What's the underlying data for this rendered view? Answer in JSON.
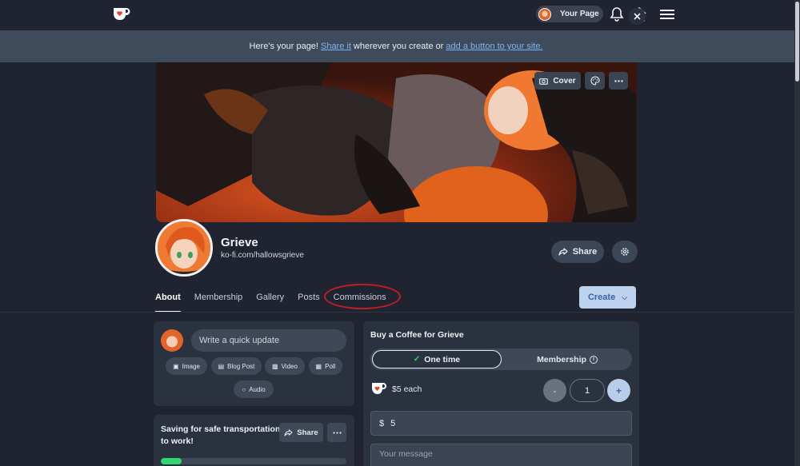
{
  "nav": {
    "your_page_label": "Your Page",
    "icons": [
      "kofi-logo-icon",
      "bell-icon",
      "home-icon",
      "menu-icon"
    ]
  },
  "banner": {
    "prefix": "Here's your page!",
    "link1": "Share it",
    "middle": "wherever you create or",
    "link2": "add a button to your site."
  },
  "cover": {
    "cover_label": "Cover"
  },
  "profile": {
    "name": "Grieve",
    "url": "ko-fi.com/hallowsgrieve",
    "share_label": "Share"
  },
  "tabs": [
    {
      "label": "About",
      "active": true
    },
    {
      "label": "Membership",
      "active": false
    },
    {
      "label": "Gallery",
      "active": false
    },
    {
      "label": "Posts",
      "active": false
    },
    {
      "label": "Commissions",
      "active": false
    }
  ],
  "create_label": "Create",
  "update": {
    "placeholder": "Write a quick update",
    "actions": [
      {
        "label": "Image",
        "icon": "image-icon"
      },
      {
        "label": "Blog Post",
        "icon": "blog-post-icon"
      },
      {
        "label": "Video",
        "icon": "video-icon"
      },
      {
        "label": "Poll",
        "icon": "poll-icon"
      },
      {
        "label": "Audio",
        "icon": "audio-icon"
      }
    ]
  },
  "goal": {
    "title": "Saving for safe transportation to work!",
    "share_label": "Share",
    "progress_fraction": 0.11,
    "progress_color": "#2fd86f"
  },
  "buy": {
    "title": "Buy a Coffee for Grieve",
    "one_time_label": "One time",
    "membership_label": "Membership",
    "price_each": "$5 each",
    "quantity": "1",
    "minus": "-",
    "plus": "+",
    "currency": "$",
    "amount": "5",
    "message_placeholder": "Your message"
  },
  "colors": {
    "background": "#1f2430",
    "panel": "#2a3240",
    "banner": "#3e4b5b",
    "link": "#7db3f0",
    "accent_red": "#c21d24",
    "create_bg": "#bcd2ee"
  }
}
